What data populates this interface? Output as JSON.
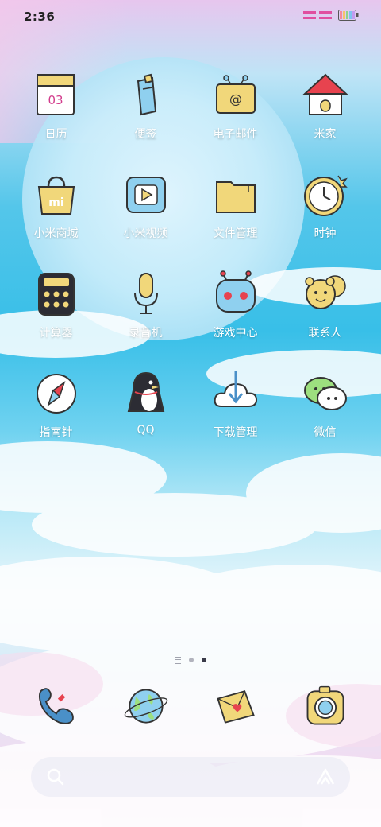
{
  "status": {
    "time": "2:36"
  },
  "calendar_day": "03",
  "apps": [
    {
      "label": "日历",
      "icon": "calendar-icon"
    },
    {
      "label": "便签",
      "icon": "notes-icon"
    },
    {
      "label": "电子邮件",
      "icon": "email-icon"
    },
    {
      "label": "米家",
      "icon": "home-icon"
    },
    {
      "label": "小米商城",
      "icon": "store-icon"
    },
    {
      "label": "小米视频",
      "icon": "video-icon"
    },
    {
      "label": "文件管理",
      "icon": "folder-icon"
    },
    {
      "label": "时钟",
      "icon": "clock-icon"
    },
    {
      "label": "计算器",
      "icon": "calculator-icon"
    },
    {
      "label": "录音机",
      "icon": "microphone-icon"
    },
    {
      "label": "游戏中心",
      "icon": "game-icon"
    },
    {
      "label": "联系人",
      "icon": "contacts-icon"
    },
    {
      "label": "指南针",
      "icon": "compass-icon"
    },
    {
      "label": "QQ",
      "icon": "penguin-icon"
    },
    {
      "label": "下载管理",
      "icon": "download-icon"
    },
    {
      "label": "微信",
      "icon": "chat-icon"
    }
  ],
  "dock": [
    {
      "icon": "phone-icon"
    },
    {
      "icon": "browser-globe-icon"
    },
    {
      "icon": "messages-envelope-icon"
    },
    {
      "icon": "camera-icon"
    }
  ],
  "pager": {
    "pages": 2,
    "active": 2
  },
  "colors": {
    "sky": "#38bfe8",
    "label": "#ffffff",
    "icon_yellow": "#f1d77a",
    "icon_blue": "#8fd0ef"
  }
}
